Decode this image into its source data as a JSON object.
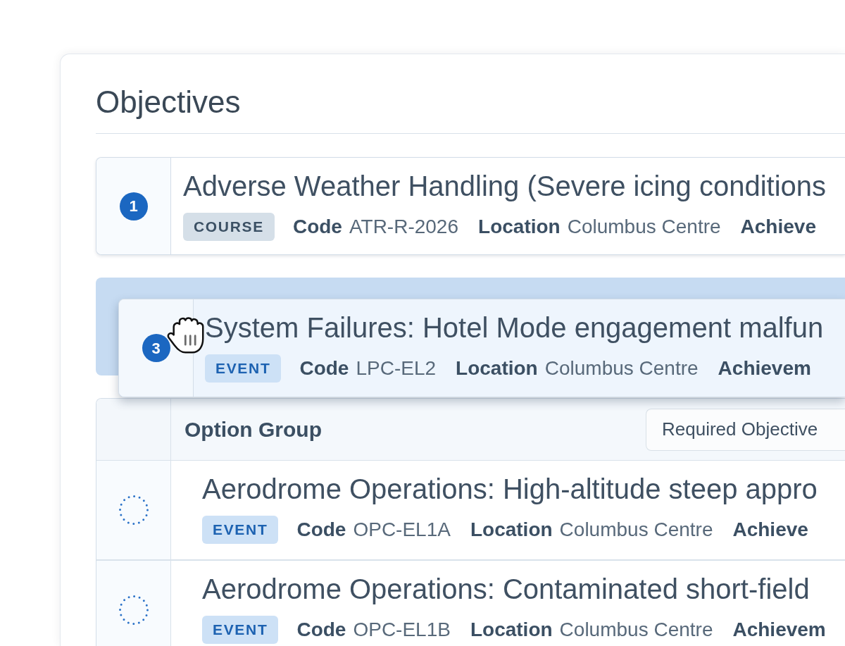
{
  "panel": {
    "title": "Objectives"
  },
  "objectives": [
    {
      "kind": "objective",
      "number": "1",
      "dragging": false,
      "title": "Adverse Weather Handling (Severe icing conditions",
      "badge": {
        "text": "COURSE",
        "kind": "course"
      },
      "meta": [
        {
          "label": "Code",
          "value": "ATR-R-2026"
        },
        {
          "label": "Location",
          "value": "Columbus Centre"
        },
        {
          "label": "Achieve"
        }
      ]
    },
    {
      "kind": "objective",
      "number": "3",
      "dragging": true,
      "title": "System Failures: Hotel Mode engagement malfun",
      "badge": {
        "text": "EVENT",
        "kind": "event"
      },
      "meta": [
        {
          "label": "Code",
          "value": "LPC-EL2"
        },
        {
          "label": "Location",
          "value": "Columbus Centre"
        },
        {
          "label": "Achievem"
        }
      ]
    },
    {
      "kind": "option_group",
      "heading": "Option Group",
      "control": "Required Objective",
      "items": [
        {
          "title": "Aerodrome Operations: High-altitude steep appro",
          "badge": {
            "text": "EVENT",
            "kind": "event"
          },
          "meta": [
            {
              "label": "Code",
              "value": "OPC-EL1A"
            },
            {
              "label": "Location",
              "value": "Columbus Centre"
            },
            {
              "label": "Achieve"
            }
          ]
        },
        {
          "title": "Aerodrome Operations: Contaminated short-field",
          "badge": {
            "text": "EVENT",
            "kind": "event"
          },
          "meta": [
            {
              "label": "Code",
              "value": "OPC-EL1B"
            },
            {
              "label": "Location",
              "value": "Columbus Centre"
            },
            {
              "label": "Achievem"
            }
          ]
        }
      ]
    }
  ]
}
